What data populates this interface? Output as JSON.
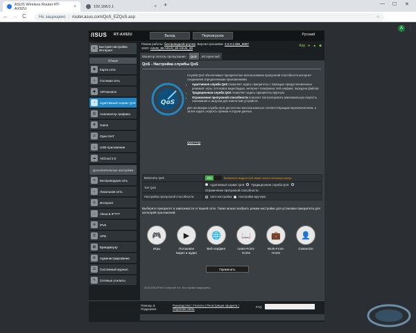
{
  "browser": {
    "tab1_title": "ASUS Wireless Router RT-AX92U",
    "tab1_close": "×",
    "tab2_title": "192.168.0.1",
    "tab2_close": "×",
    "new_tab": "+",
    "back": "←",
    "forward": "→",
    "reload": "C",
    "insecure_label": "Не защищено",
    "separator": "|",
    "url": "router.asus.com/QoS_EZQoS.asp",
    "bookmark_star": "☆",
    "avatar_letter": "A",
    "menu": "⋮",
    "minimize": "—",
    "maximize": "☐",
    "close": "✕"
  },
  "router": {
    "logo": "/ISUS",
    "model": "RT-AX92U",
    "logout": "Выход",
    "reboot": "Перезагрузка",
    "language": "Русский",
    "status_mode_label": "Режим работы:",
    "status_mode_value": "беспроводной роутер",
    "status_fw_label": "Версия прошивки:",
    "status_fw_value": "3.0.0.4.384_8087",
    "status_ssid_label": "SSID:",
    "status_ssid_values": "ASUS_80  ASUS_80  ASUS_80",
    "status_app": "App",
    "quick_setup": "Быстрая настройка Интернет",
    "section_general": "Общие",
    "section_advanced": "Дополнительные настройки",
    "nav": {
      "network_map": "Карта сети",
      "guest": "Гостевая сеть",
      "aiprotection": "AiProtection",
      "qos": "Адаптивный сервис QoS",
      "traffic": "Анализатор трафика",
      "game": "Game",
      "open_nat": "Open NAT",
      "usb": "USB-приложение",
      "aicloud": "AiCloud 2.0",
      "wireless": "Беспроводная сеть",
      "lan": "Локальная сеть",
      "wan": "Интернет",
      "alexa": "Alexa & IFTTT",
      "ipv6": "IPv6",
      "vpn": "VPN",
      "firewall": "Брандмауэр",
      "admin": "Администрирование",
      "syslog": "Системный журнал",
      "tools": "Сетевые утилиты"
    },
    "tabs": {
      "bandwidth": "Монитор полосы пропускания",
      "qos": "QoS",
      "history": "История веб"
    },
    "page_title": "QoS - Настройка службы QoS",
    "desc_intro": "Служба QoS обеспечивает приоритетное использование пропускной способности интернет-соединения определенными приложениями.",
    "bullet1_bold": "Адаптивная служба QoS",
    "bullet1_text": " позволяет задать приоритеты с помощью предустановленных режимов: игры, потоковое видео/аудио, интернет-телефония, веб-серфинг, передача файлов.",
    "bullet2_bold": "Традиционная служба QoS",
    "bullet2_text": " позволяет задать приоритеты вручную.",
    "bullet3_bold": "Ограничение пропускной способности",
    "bullet3_text": " помогает контролировать максимальную скорость скачивания и загрузки для клиентских устройств.",
    "desc_outro": "Для активации службы QoS достаточно воспользоваться соответствующим переключателем, а затем задать скорость приема и отдачи данных.",
    "faq_link": "QoS FAQ",
    "enable_qos_label": "Включить QoS",
    "toggle_on": "ON",
    "enable_note": "Включение модуля QoS может занять несколько минут.",
    "qos_type_label": "Тип QoS",
    "qos_type_opt1": "Адаптивный сервис QoS",
    "qos_type_opt2": "Традиционная служба QoS",
    "qos_type_opt3": "Ограничение пропускной способности",
    "bandwidth_label": "Настройка пропускной способности",
    "bw_opt1": "Авто-настройка",
    "bw_opt2": "Настройка вручную",
    "prompt": "Выберите приоритет в зависимости от вашей сети. Также можно выбрать режим настройки для установки приоритета для категорий приложений.",
    "priorities": [
      {
        "label": "Игры",
        "icon": "🎮"
      },
      {
        "label": "Потоковое видео и аудио",
        "icon": "▶"
      },
      {
        "label": "Веб-серфинг",
        "icon": "🌐"
      },
      {
        "label": "Learn-From-Home",
        "icon": "📖"
      },
      {
        "label": "Work-From-Home",
        "icon": "💼"
      },
      {
        "label": "Customize",
        "icon": "👤"
      }
    ],
    "apply": "Применить",
    "footer_help": "Помощь & Поддержка",
    "footer_links": "Руководство | Утилиты | Регистрация продукта | Обратная связь",
    "footer_faq": "FAQ",
    "copyright": "2020 ASUSTeK Computer Inc. Все права защищены."
  },
  "colors": {
    "accent": "#1e87c7",
    "on_green": "#4caf50",
    "warn_orange": "#ff9800"
  }
}
